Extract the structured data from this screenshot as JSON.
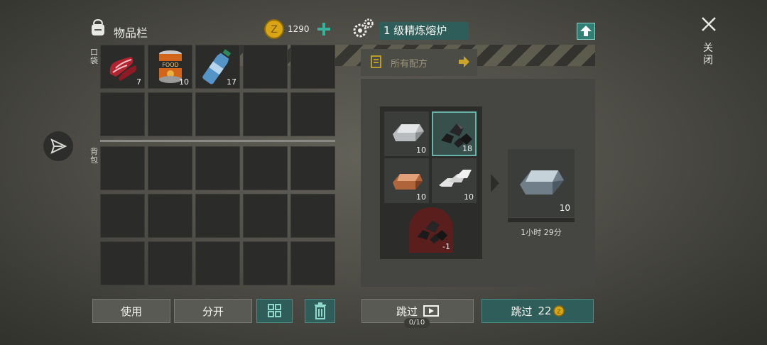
{
  "inventory": {
    "title": "物品栏",
    "pocket_label": "口袋",
    "backpack_label": "背包",
    "items": [
      {
        "name": "raw-meat",
        "count": "7"
      },
      {
        "name": "canned-food",
        "count": "10",
        "can_text": "FOOD"
      },
      {
        "name": "water-bottle",
        "count": "17"
      }
    ]
  },
  "currency": {
    "amount": "1290"
  },
  "workbench": {
    "title": "1 级精炼熔炉",
    "recipes_label": "所有配方",
    "inputs": [
      {
        "name": "iron-ingot",
        "count": "10"
      },
      {
        "name": "coal",
        "count": "18"
      },
      {
        "name": "copper-ingot",
        "count": "10"
      },
      {
        "name": "silver-bars",
        "count": "10"
      }
    ],
    "fuel": {
      "name": "coal-fuel",
      "count": "-1"
    },
    "output": {
      "name": "steel-ingot",
      "count": "10",
      "time": "1小时 29分"
    }
  },
  "buttons": {
    "use": "使用",
    "split": "分开",
    "skip": "跳过",
    "skip_counter": "0/10",
    "skip_paid": "跳过",
    "skip_cost": "22"
  },
  "close": {
    "label": "关闭"
  },
  "colors": {
    "teal": "#2f5d59",
    "accent_green": "#35b39a",
    "coin": "#d9a514"
  }
}
